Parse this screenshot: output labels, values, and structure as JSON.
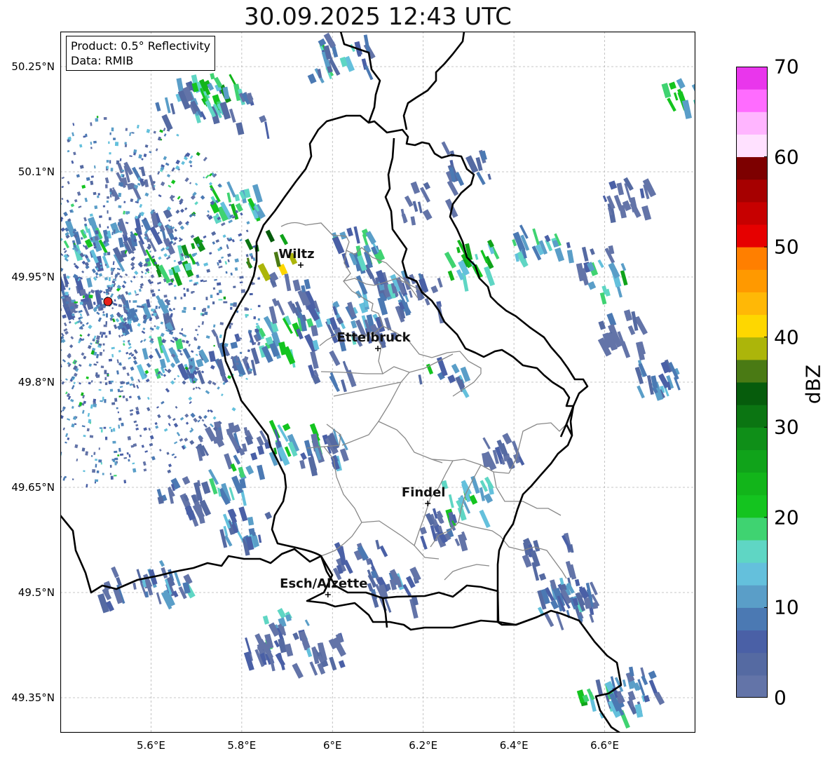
{
  "title": "30.09.2025 12:43 UTC",
  "info_box": {
    "product": "Product: 0.5° Reflectivity",
    "data_source": "Data: RMIB"
  },
  "axes": {
    "lon_range": [
      5.4,
      6.8
    ],
    "lat_range": [
      49.3,
      50.3
    ],
    "lon_ticks": [
      {
        "value": 5.6,
        "label": "5.6°E"
      },
      {
        "value": 5.8,
        "label": "5.8°E"
      },
      {
        "value": 6.0,
        "label": "6°E"
      },
      {
        "value": 6.2,
        "label": "6.2°E"
      },
      {
        "value": 6.4,
        "label": "6.4°E"
      },
      {
        "value": 6.6,
        "label": "6.6°E"
      }
    ],
    "lat_ticks": [
      {
        "value": 50.25,
        "label": "50.25°N"
      },
      {
        "value": 50.1,
        "label": "50.1°N"
      },
      {
        "value": 49.95,
        "label": "49.95°N"
      },
      {
        "value": 49.8,
        "label": "49.8°N"
      },
      {
        "value": 49.65,
        "label": "49.65°N"
      },
      {
        "value": 49.5,
        "label": "49.5°N"
      },
      {
        "value": 49.35,
        "label": "49.35°N"
      }
    ],
    "grid": true
  },
  "cities": [
    {
      "name": "Wiltz",
      "lon": 5.93,
      "lat": 49.967
    },
    {
      "name": "Ettelbruck",
      "lon": 6.1,
      "lat": 49.848
    },
    {
      "name": "Findel",
      "lon": 6.21,
      "lat": 49.627
    },
    {
      "name": "Esch/Alzette",
      "lon": 5.99,
      "lat": 49.497
    }
  ],
  "radar_site": {
    "lon": 5.505,
    "lat": 49.915,
    "color": "#e8201a"
  },
  "colorbar": {
    "unit": "dBZ",
    "min": 0,
    "max": 70,
    "step": 2.5,
    "tick_labels": [
      "0",
      "10",
      "20",
      "30",
      "40",
      "50",
      "60",
      "70"
    ],
    "colors": [
      "#6374a8",
      "#556aa2",
      "#4a60a6",
      "#4b79b3",
      "#5a9ec8",
      "#64c0dc",
      "#5fd6c4",
      "#3fd371",
      "#14c41f",
      "#12b51a",
      "#10a31a",
      "#0f8f18",
      "#0b7512",
      "#065c0c",
      "#4a7a14",
      "#acb50a",
      "#fed700",
      "#ffb806",
      "#ff9900",
      "#ff7f00",
      "#e60000",
      "#c70000",
      "#a60000",
      "#7d0000",
      "#ffe1ff",
      "#ffb5ff",
      "#ff6cff",
      "#e936ec"
    ]
  },
  "radar_echoes": [
    {
      "lon": 5.7,
      "lat": 50.21,
      "dbz": 18
    },
    {
      "lon": 5.74,
      "lat": 50.22,
      "dbz": 25
    },
    {
      "lon": 5.66,
      "lat": 50.2,
      "dbz": 12
    },
    {
      "lon": 5.8,
      "lat": 50.19,
      "dbz": 8
    },
    {
      "lon": 5.99,
      "lat": 50.26,
      "dbz": 20
    },
    {
      "lon": 6.02,
      "lat": 50.27,
      "dbz": 12
    },
    {
      "lon": 5.45,
      "lat": 50.01,
      "dbz": 22
    },
    {
      "lon": 5.5,
      "lat": 50.0,
      "dbz": 15
    },
    {
      "lon": 5.58,
      "lat": 50.02,
      "dbz": 10
    },
    {
      "lon": 5.64,
      "lat": 49.98,
      "dbz": 30
    },
    {
      "lon": 5.43,
      "lat": 49.93,
      "dbz": 8
    },
    {
      "lon": 5.58,
      "lat": 49.9,
      "dbz": 12
    },
    {
      "lon": 5.62,
      "lat": 49.84,
      "dbz": 18
    },
    {
      "lon": 5.7,
      "lat": 49.82,
      "dbz": 14
    },
    {
      "lon": 5.78,
      "lat": 49.85,
      "dbz": 10
    },
    {
      "lon": 5.88,
      "lat": 49.87,
      "dbz": 22
    },
    {
      "lon": 5.96,
      "lat": 49.88,
      "dbz": 14
    },
    {
      "lon": 6.04,
      "lat": 49.89,
      "dbz": 18
    },
    {
      "lon": 5.86,
      "lat": 49.99,
      "dbz": 40
    },
    {
      "lon": 5.91,
      "lat": 49.93,
      "dbz": 10
    },
    {
      "lon": 6.1,
      "lat": 49.95,
      "dbz": 15
    },
    {
      "lon": 6.14,
      "lat": 49.94,
      "dbz": 12
    },
    {
      "lon": 6.18,
      "lat": 49.93,
      "dbz": 10
    },
    {
      "lon": 6.08,
      "lat": 49.89,
      "dbz": 8
    },
    {
      "lon": 6.3,
      "lat": 49.98,
      "dbz": 28
    },
    {
      "lon": 6.56,
      "lat": 49.98,
      "dbz": 12
    },
    {
      "lon": 6.61,
      "lat": 49.95,
      "dbz": 22
    },
    {
      "lon": 6.63,
      "lat": 49.88,
      "dbz": 5
    },
    {
      "lon": 6.71,
      "lat": 49.81,
      "dbz": 14
    },
    {
      "lon": 5.91,
      "lat": 49.72,
      "dbz": 22
    },
    {
      "lon": 5.97,
      "lat": 49.71,
      "dbz": 12
    },
    {
      "lon": 5.82,
      "lat": 49.72,
      "dbz": 8
    },
    {
      "lon": 5.73,
      "lat": 49.72,
      "dbz": 6
    },
    {
      "lon": 5.8,
      "lat": 49.6,
      "dbz": 15
    },
    {
      "lon": 5.66,
      "lat": 49.64,
      "dbz": 8
    },
    {
      "lon": 5.53,
      "lat": 49.51,
      "dbz": 10
    },
    {
      "lon": 5.62,
      "lat": 49.52,
      "dbz": 14
    },
    {
      "lon": 5.9,
      "lat": 49.45,
      "dbz": 18
    },
    {
      "lon": 5.85,
      "lat": 49.43,
      "dbz": 8
    },
    {
      "lon": 5.96,
      "lat": 49.42,
      "dbz": 6
    },
    {
      "lon": 6.05,
      "lat": 49.55,
      "dbz": 8
    },
    {
      "lon": 6.13,
      "lat": 49.51,
      "dbz": 10
    },
    {
      "lon": 6.29,
      "lat": 49.64,
      "dbz": 22
    },
    {
      "lon": 6.23,
      "lat": 49.6,
      "dbz": 8
    },
    {
      "lon": 6.47,
      "lat": 49.56,
      "dbz": 8
    },
    {
      "lon": 6.49,
      "lat": 49.5,
      "dbz": 14
    },
    {
      "lon": 6.52,
      "lat": 49.49,
      "dbz": 10
    },
    {
      "lon": 6.59,
      "lat": 49.35,
      "dbz": 22
    },
    {
      "lon": 6.63,
      "lat": 49.36,
      "dbz": 16
    },
    {
      "lon": 6.66,
      "lat": 49.37,
      "dbz": 12
    },
    {
      "lon": 6.37,
      "lat": 49.7,
      "dbz": 6
    },
    {
      "lon": 6.44,
      "lat": 50.0,
      "dbz": 20
    },
    {
      "lon": 6.64,
      "lat": 50.07,
      "dbz": 8
    },
    {
      "lon": 6.2,
      "lat": 50.06,
      "dbz": 8
    },
    {
      "lon": 6.29,
      "lat": 50.12,
      "dbz": 10
    },
    {
      "lon": 6.75,
      "lat": 50.22,
      "dbz": 24
    },
    {
      "lon": 5.55,
      "lat": 50.09,
      "dbz": 6
    },
    {
      "lon": 5.78,
      "lat": 50.06,
      "dbz": 24
    },
    {
      "lon": 6.05,
      "lat": 50.0,
      "dbz": 20
    },
    {
      "lon": 5.98,
      "lat": 49.82,
      "dbz": 10
    },
    {
      "lon": 6.24,
      "lat": 49.81,
      "dbz": 16
    },
    {
      "lon": 5.78,
      "lat": 49.67,
      "dbz": 20
    }
  ]
}
